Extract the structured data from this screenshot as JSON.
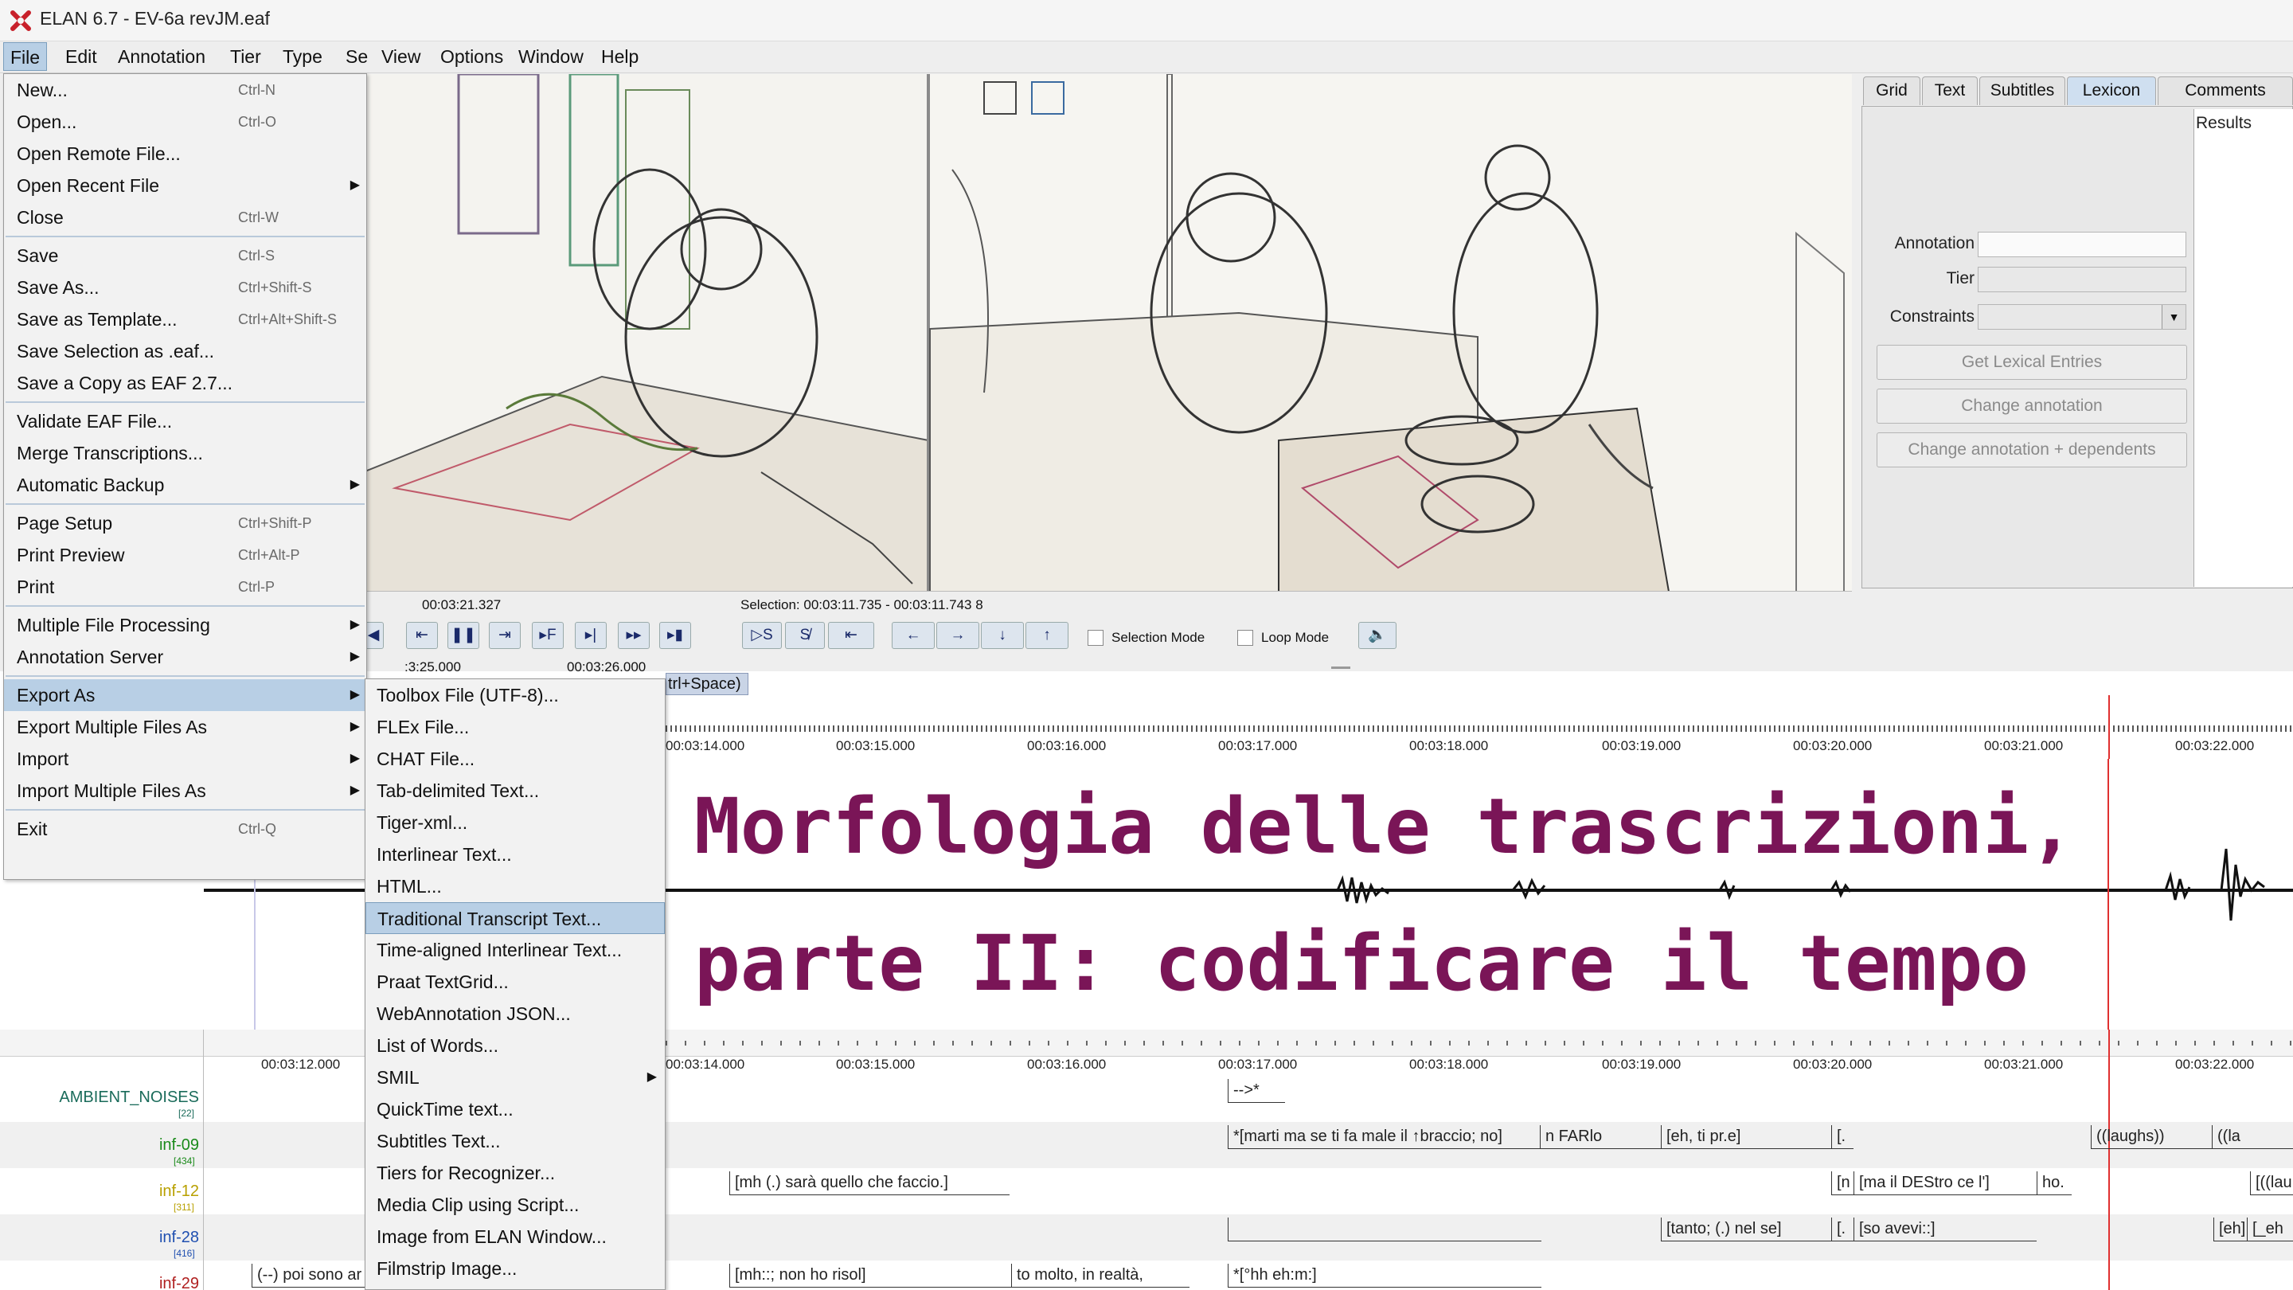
{
  "window": {
    "title": "ELAN 6.7 - EV-6a revJM.eaf"
  },
  "menubar": [
    {
      "id": "file",
      "label": "File"
    },
    {
      "id": "edit",
      "label": "Edit"
    },
    {
      "id": "annotation",
      "label": "Annotation"
    },
    {
      "id": "tier",
      "label": "Tier"
    },
    {
      "id": "type",
      "label": "Type"
    },
    {
      "id": "search",
      "label": "Se"
    },
    {
      "id": "view",
      "label": "View"
    },
    {
      "id": "options",
      "label": "Options"
    },
    {
      "id": "window",
      "label": "Window"
    },
    {
      "id": "help",
      "label": "Help"
    }
  ],
  "file_menu": {
    "items": [
      {
        "label": "New...",
        "shortcut": "Ctrl-N"
      },
      {
        "label": "Open...",
        "shortcut": "Ctrl-O"
      },
      {
        "label": "Open Remote File...",
        "shortcut": ""
      },
      {
        "label": "Open Recent File",
        "shortcut": "",
        "submenu": true
      },
      {
        "label": "Close",
        "shortcut": "Ctrl-W"
      },
      {
        "label": "Save",
        "shortcut": "Ctrl-S"
      },
      {
        "label": "Save As...",
        "shortcut": "Ctrl+Shift-S"
      },
      {
        "label": "Save as Template...",
        "shortcut": "Ctrl+Alt+Shift-S"
      },
      {
        "label": "Save Selection as .eaf...",
        "shortcut": ""
      },
      {
        "label": "Save a Copy as EAF 2.7...",
        "shortcut": ""
      },
      {
        "label": "Validate EAF File...",
        "shortcut": ""
      },
      {
        "label": "Merge Transcriptions...",
        "shortcut": ""
      },
      {
        "label": "Automatic Backup",
        "shortcut": "",
        "submenu": true
      },
      {
        "label": "Page Setup",
        "shortcut": "Ctrl+Shift-P"
      },
      {
        "label": "Print Preview",
        "shortcut": "Ctrl+Alt-P"
      },
      {
        "label": "Print",
        "shortcut": "Ctrl-P"
      },
      {
        "label": "Multiple File Processing",
        "shortcut": "",
        "submenu": true
      },
      {
        "label": "Annotation Server",
        "shortcut": "",
        "submenu": true
      },
      {
        "label": "Export As",
        "shortcut": "",
        "submenu": true
      },
      {
        "label": "Export Multiple Files As",
        "shortcut": "",
        "submenu": true
      },
      {
        "label": "Import",
        "shortcut": "",
        "submenu": true
      },
      {
        "label": "Import Multiple Files As",
        "shortcut": "",
        "submenu": true
      },
      {
        "label": "Exit",
        "shortcut": "Ctrl-Q"
      }
    ]
  },
  "export_submenu": {
    "items": [
      {
        "label": "Toolbox File (UTF-8)..."
      },
      {
        "label": "FLEx File..."
      },
      {
        "label": "CHAT File..."
      },
      {
        "label": "Tab-delimited Text..."
      },
      {
        "label": "Tiger-xml..."
      },
      {
        "label": "Interlinear Text..."
      },
      {
        "label": "HTML..."
      },
      {
        "label": "Traditional Transcript Text..."
      },
      {
        "label": "Time-aligned Interlinear Text..."
      },
      {
        "label": "Praat TextGrid..."
      },
      {
        "label": "WebAnnotation JSON..."
      },
      {
        "label": "List of Words..."
      },
      {
        "label": "SMIL",
        "submenu": true
      },
      {
        "label": "QuickTime text..."
      },
      {
        "label": "Subtitles Text..."
      },
      {
        "label": "Tiers for Recognizer..."
      },
      {
        "label": "Media Clip using Script..."
      },
      {
        "label": "Image from ELAN Window..."
      },
      {
        "label": "Filmstrip Image..."
      }
    ]
  },
  "side_panel": {
    "tabs": [
      {
        "id": "grid",
        "label": "Grid"
      },
      {
        "id": "text",
        "label": "Text"
      },
      {
        "id": "subtitles",
        "label": "Subtitles"
      },
      {
        "id": "lexicon",
        "label": "Lexicon"
      },
      {
        "id": "comments",
        "label": "Comments"
      }
    ],
    "results_label": "Results",
    "annotation_label": "Annotation",
    "tier_label": "Tier",
    "constraints_label": "Constraints",
    "get_lexical": "Get Lexical Entries",
    "change_annotation": "Change annotation",
    "change_annotation_dependents": "Change annotation + dependents"
  },
  "controls": {
    "current_time": "00:03:21.327",
    "selection": "Selection: 00:03:11.735 - 00:03:11.743  8",
    "selection_mode": "Selection Mode",
    "loop_mode": "Loop Mode",
    "tooltip_fragment": "trl+Space)",
    "left_ruler_start": ":3:25.000",
    "left_ruler_end": "00:03:26.000"
  },
  "timeline": {
    "ticks": [
      "00:03:14.000",
      "00:03:15.000",
      "00:03:16.000",
      "00:03:17.000",
      "00:03:18.000",
      "00:03:19.000",
      "00:03:20.000",
      "00:03:21.000",
      "00:03:22.000"
    ],
    "lower_first_tick": "00:03:12.000"
  },
  "tiers": [
    {
      "name": "AMBIENT_NOISES",
      "count": "[22]",
      "color": "#1a6b5a"
    },
    {
      "name": "inf-09",
      "count": "[434]",
      "color": "#1a8a1a"
    },
    {
      "name": "inf-12",
      "count": "[311]",
      "color": "#b8a000"
    },
    {
      "name": "inf-28",
      "count": "[416]",
      "color": "#1f4fb0"
    },
    {
      "name": "inf-29",
      "count": "",
      "color": "#b02020"
    }
  ],
  "annotations": {
    "ambient_1": "-->*",
    "inf09_1": "*[marti ma se ti fa male il ↑braccio; no]",
    "inf09_2": "n FARlo",
    "inf09_3": "[eh, ti pr.e]",
    "inf09_4": "[.",
    "inf09_5": "((laughs))",
    "inf09_6": "((la",
    "inf12_1": "[mh (.) sarà quello che faccio.]",
    "inf12_2": "[n",
    "inf12_3": "[ma il DEStro ce l']",
    "inf12_4": "ho.",
    "inf12_5": "[((lau",
    "inf28_1": "[tanto; (.) nel se]",
    "inf28_2": "[.",
    "inf28_3": "[so avevi::]",
    "inf28_4": "[eh]",
    "inf28_5": "[_eh",
    "inf29_0": "(--) poi sono ar",
    "inf29_1": "[mh::; non ho risol]",
    "inf29_2": "to molto, in realtà,",
    "inf29_3": "*[°hh eh:m:]"
  },
  "overlay": {
    "line1": "Morfologia delle trascrizioni,",
    "line2": "parte II: codificare il tempo"
  },
  "colors": {
    "overlay_text": "#7a1557",
    "menu_highlight": "#b8cfe5",
    "cursor": "#e03030"
  }
}
